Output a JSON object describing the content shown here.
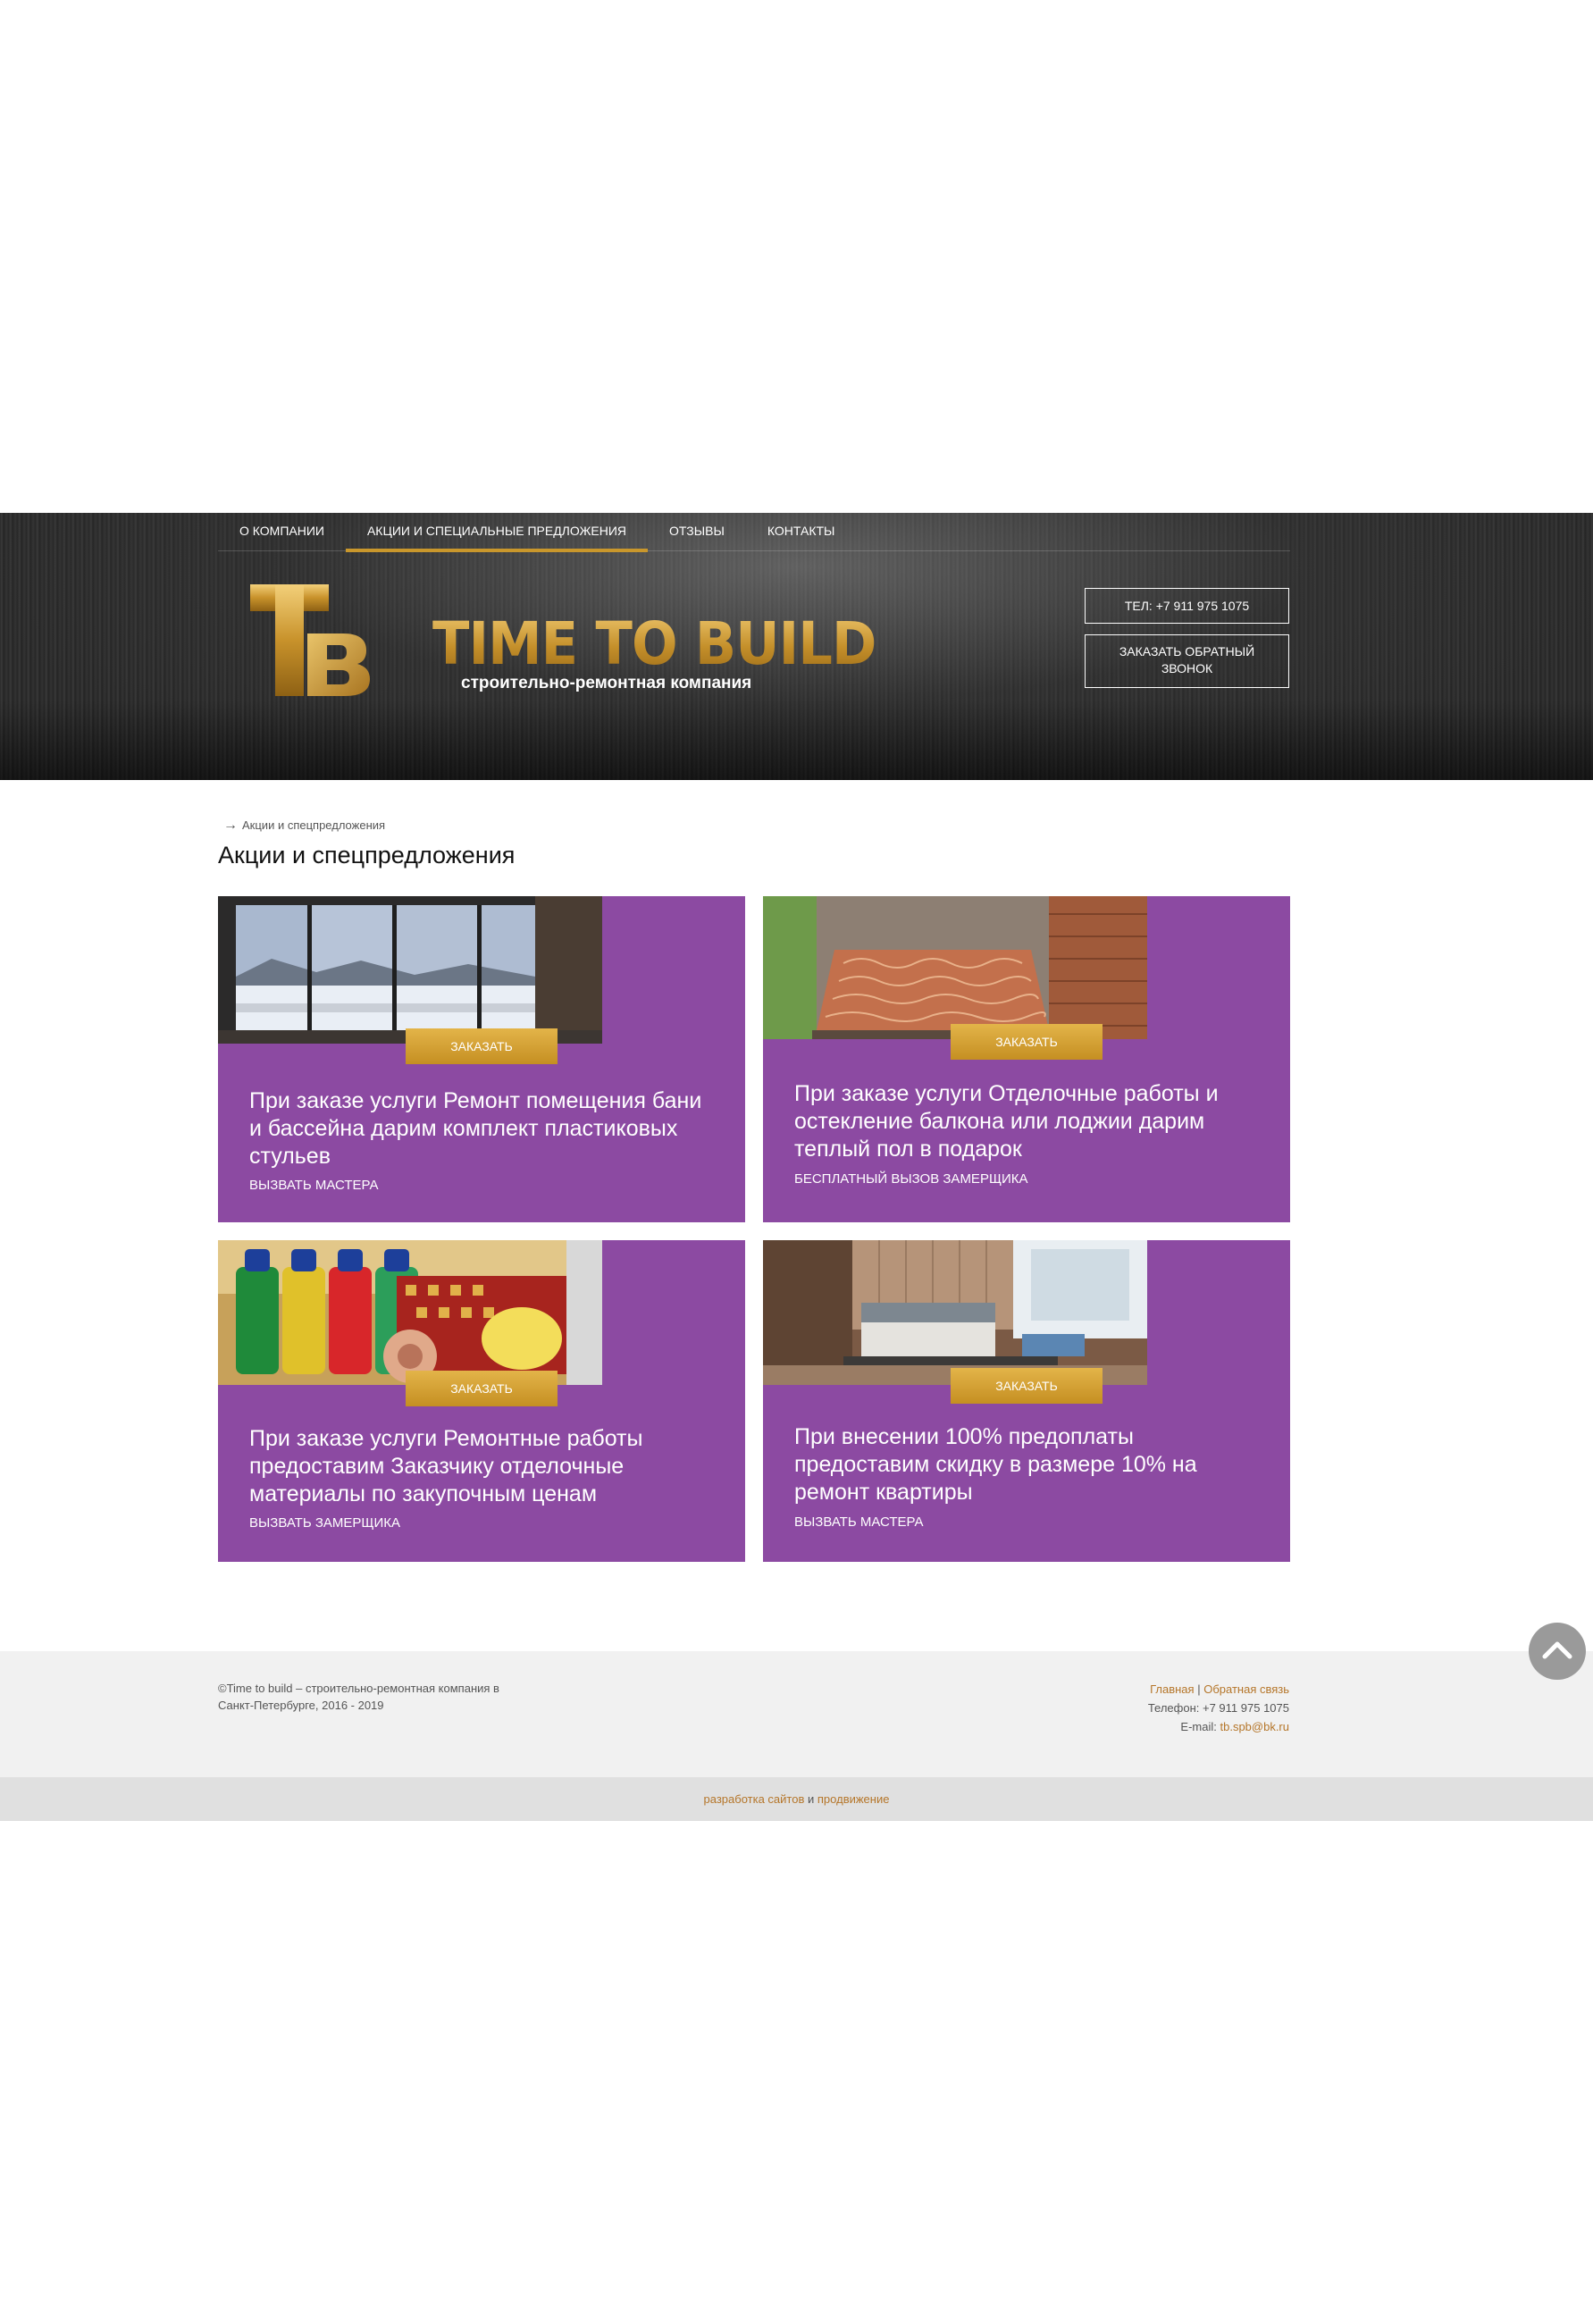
{
  "nav": {
    "items": [
      {
        "label": "О компании"
      },
      {
        "label": "Акции и специальные предложения"
      },
      {
        "label": "Отзывы"
      },
      {
        "label": "Контакты"
      }
    ]
  },
  "brand": {
    "logo_letters": "TB",
    "title": "TIME TO BUILD",
    "subtitle": "строительно-ремонтная компания",
    "accent_color": "#c9972c"
  },
  "header_buttons": {
    "phone": "ТЕЛ: +7 911 975 1075",
    "callback": "ЗАКАЗАТЬ ОБРАТНЫЙ ЗВОНОК"
  },
  "breadcrumb": {
    "arrow": "→",
    "current": "Акции и спецпредложения"
  },
  "page": {
    "title": "Акции и спецпредложения"
  },
  "offers": [
    {
      "image": "window-winter-view",
      "button": "ЗАКАЗАТЬ",
      "title": "При заказе услуги Ремонт помещения бани и бассейна дарим комплект пластиковых стульев",
      "action": "ВЫЗВАТЬ МАСТЕРА"
    },
    {
      "image": "balcony-heated-floor",
      "button": "ЗАКАЗАТЬ",
      "title": "При заказе услуги Отделочные работы и остекление балкона или лоджии дарим теплый пол в подарок",
      "action": "БЕСПЛАТНЫЙ ВЫЗОВ ЗАМЕРЩИКА"
    },
    {
      "image": "paint-and-rolls",
      "button": "ЗАКАЗАТЬ",
      "title": "При заказе услуги Ремонтные работы предоставим Заказчику отделочные материалы по закупочным ценам",
      "action": "ВЫЗВАТЬ ЗАМЕРЩИКА"
    },
    {
      "image": "bedroom-interior",
      "button": "ЗАКАЗАТЬ",
      "title": "При внесении 100% предоплаты предоставим скидку в размере 10% на ремонт квартиры",
      "action": "ВЫЗВАТЬ МАСТЕРА"
    }
  ],
  "card_color": "#8c4aa2",
  "footer": {
    "copyright": "©Time to build – строительно-ремонтная компания в Санкт-Петербурге, 2016 - 2019",
    "link_home": "Главная",
    "separator": "|",
    "link_feedback": "Обратная связь",
    "phone_label": "Телефон:",
    "phone": "+7 911 975 1075",
    "email_label": "E-mail:",
    "email": "tb.spb@bk.ru"
  },
  "subfooter": {
    "link_dev": "разработка сайтов",
    "conj": "и",
    "link_promo": "продвижение"
  },
  "scroll_top": {
    "icon": "chevron-up-icon"
  }
}
